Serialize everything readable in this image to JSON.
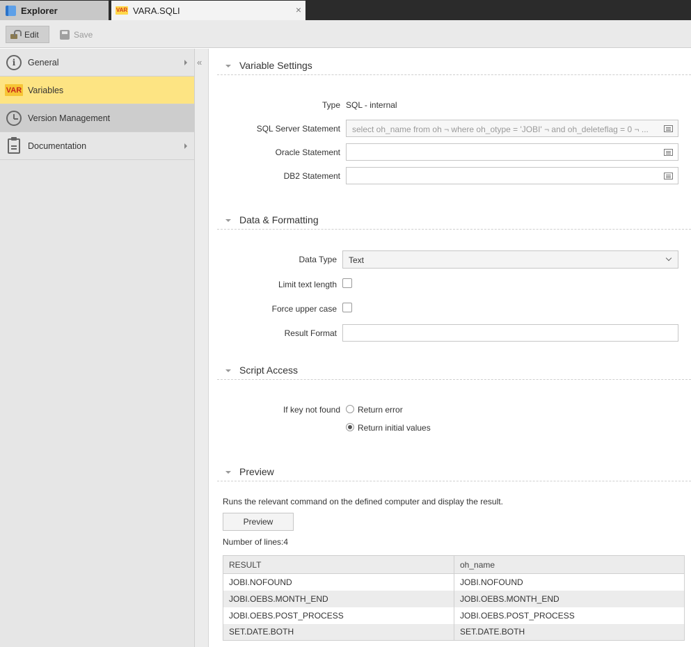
{
  "tabs": [
    {
      "label": "Explorer",
      "icon": "book-icon"
    },
    {
      "label": "VARA.SQLI",
      "icon": "var-icon"
    }
  ],
  "toolbar": {
    "edit_label": "Edit",
    "save_label": "Save"
  },
  "sidebar": {
    "items": [
      {
        "label": "General",
        "icon": "info-icon"
      },
      {
        "label": "Variables",
        "icon": "var-icon",
        "badge": "VAR"
      },
      {
        "label": "Version Management",
        "icon": "clock-icon"
      },
      {
        "label": "Documentation",
        "icon": "clipboard-icon"
      }
    ],
    "collapse_glyph": "«"
  },
  "variable_settings": {
    "title": "Variable Settings",
    "type_label": "Type",
    "type_value": "SQL - internal",
    "sql_server_label": "SQL Server Statement",
    "sql_server_value": "select oh_name from oh  ¬ where oh_otype = 'JOBI'  ¬ and oh_deleteflag = 0  ¬ ...",
    "oracle_label": "Oracle Statement",
    "oracle_value": "",
    "db2_label": "DB2 Statement",
    "db2_value": ""
  },
  "data_formatting": {
    "title": "Data & Formatting",
    "data_type_label": "Data Type",
    "data_type_value": "Text",
    "limit_label": "Limit text length",
    "upper_label": "Force upper case",
    "result_format_label": "Result Format",
    "result_format_value": ""
  },
  "script_access": {
    "title": "Script Access",
    "key_label": "If key not found",
    "options": [
      "Return error",
      "Return initial values"
    ],
    "selected": "Return initial values"
  },
  "preview": {
    "title": "Preview",
    "description": "Runs the relevant command on the defined computer and display the result.",
    "button_label": "Preview",
    "lines_text": "Number of lines:4",
    "columns": [
      "RESULT",
      "oh_name"
    ],
    "rows": [
      [
        "JOBI.NOFOUND",
        "JOBI.NOFOUND"
      ],
      [
        "JOBI.OEBS.MONTH_END",
        "JOBI.OEBS.MONTH_END"
      ],
      [
        "JOBI.OEBS.POST_PROCESS",
        "JOBI.OEBS.POST_PROCESS"
      ],
      [
        "SET.DATE.BOTH",
        "SET.DATE.BOTH"
      ]
    ]
  }
}
